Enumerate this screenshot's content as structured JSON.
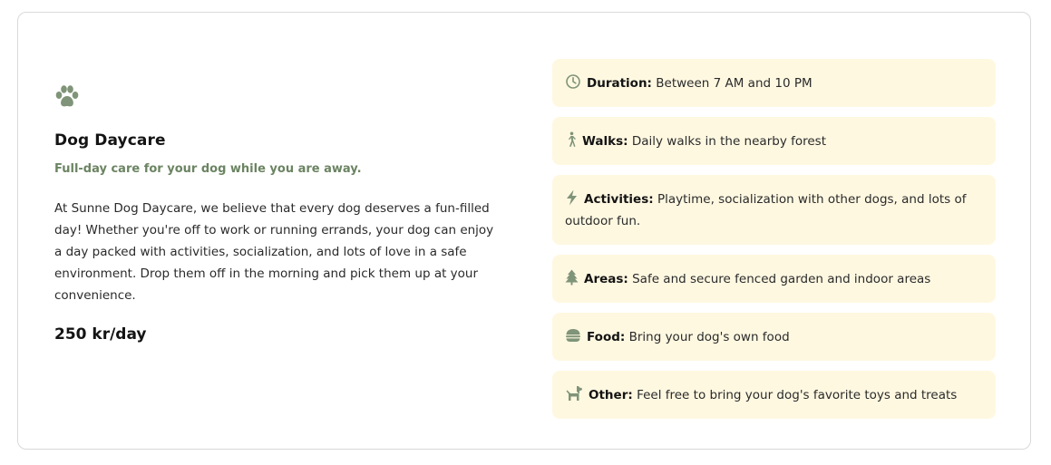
{
  "service": {
    "title": "Dog Daycare",
    "subtitle": "Full-day care for your dog while you are away.",
    "description": "At Sunne Dog Daycare, we believe that every dog deserves a fun-filled day! Whether you're off to work or running errands, your dog can enjoy a day packed with activities, socialization, and lots of love in a safe environment. Drop them off in the morning and pick them up at your convenience.",
    "price": "250 kr/day",
    "icon": "paw-icon"
  },
  "features": [
    {
      "icon": "clock-icon",
      "label": "Duration:",
      "text": "Between 7 AM and 10 PM"
    },
    {
      "icon": "walking-icon",
      "label": "Walks:",
      "text": "Daily walks in the nearby forest"
    },
    {
      "icon": "lightning-icon",
      "label": "Activities:",
      "text": "Playtime, socialization with other dogs, and lots of outdoor fun."
    },
    {
      "icon": "tree-icon",
      "label": "Areas:",
      "text": "Safe and secure fenced garden and indoor areas"
    },
    {
      "icon": "food-bowl-icon",
      "label": "Food:",
      "text": "Bring your dog's own food"
    },
    {
      "icon": "dog-icon",
      "label": "Other:",
      "text": "Feel free to bring your dog's favorite toys and treats"
    }
  ],
  "colors": {
    "accent": "#6b8462",
    "icon": "#7f9478",
    "feature_bg": "#fff8e1",
    "border": "#d9d9d9"
  }
}
